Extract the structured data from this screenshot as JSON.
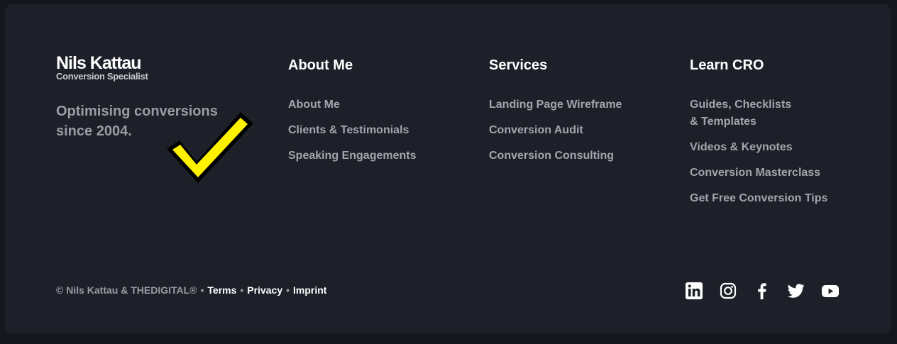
{
  "brand": {
    "name": "Nils Kattau",
    "subtitle": "Conversion Specialist"
  },
  "tagline": "Optimising conversions since 2004.",
  "columns": [
    {
      "title": "About Me",
      "items": [
        {
          "label": "About Me"
        },
        {
          "label": "Clients & Testimonials"
        },
        {
          "label": "Speaking Engagements"
        }
      ]
    },
    {
      "title": "Services",
      "items": [
        {
          "label": "Landing Page Wireframe"
        },
        {
          "label": "Conversion Audit"
        },
        {
          "label": "Conversion Consulting"
        }
      ]
    },
    {
      "title": "Learn CRO",
      "items": [
        {
          "line1": "Guides, Checklists",
          "line2": "& Templates"
        },
        {
          "label": "Videos & Keynotes"
        },
        {
          "label": "Conversion Masterclass"
        },
        {
          "label": "Get Free Conversion Tips"
        }
      ]
    }
  ],
  "legal": {
    "copyright": "© Nils Kattau & THEDIGITAL®",
    "separator": "•",
    "terms": "Terms",
    "privacy": "Privacy",
    "imprint": "Imprint"
  },
  "social": [
    "linkedin-icon",
    "instagram-icon",
    "facebook-icon",
    "twitter-icon",
    "youtube-icon"
  ],
  "colors": {
    "background": "#1e2029",
    "accent_check": "#fff200",
    "text_muted": "#a3a5ae",
    "text_white": "#ffffff"
  }
}
